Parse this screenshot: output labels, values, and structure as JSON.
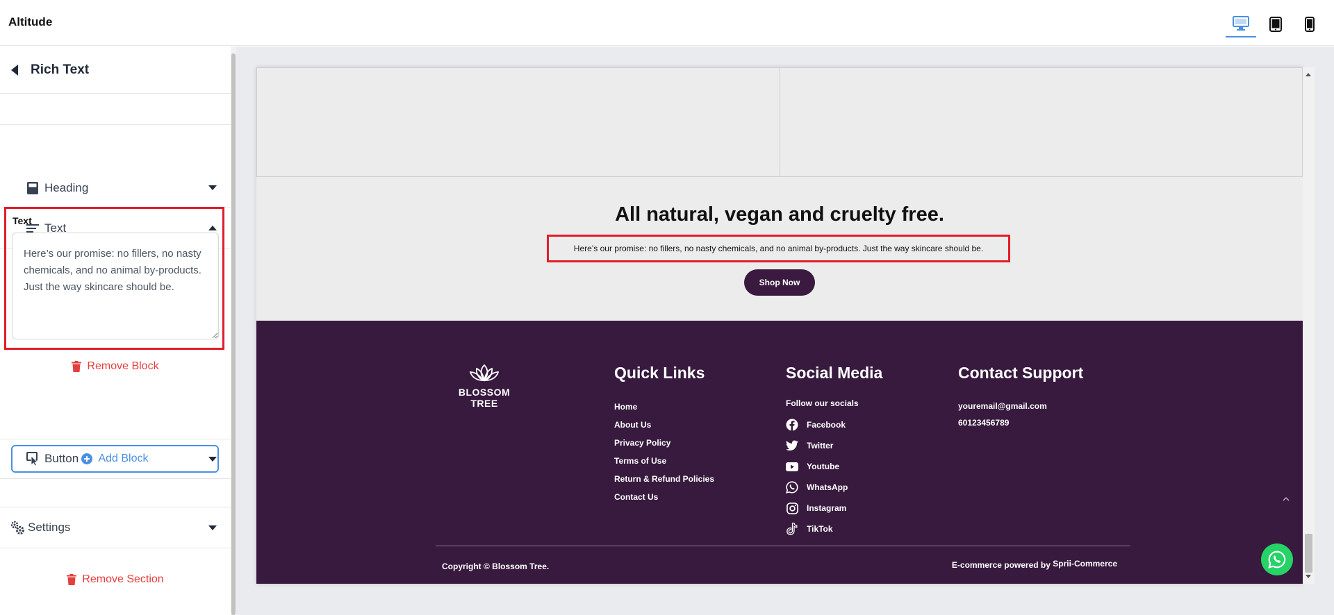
{
  "app": {
    "title": "Altitude"
  },
  "devices": [
    "desktop",
    "tablet",
    "mobile"
  ],
  "panel": {
    "title": "Rich Text",
    "blocks": [
      {
        "label": "Heading",
        "icon": "heading-block-icon",
        "state": "collapsed"
      },
      {
        "label": "Text",
        "icon": "text-lines-icon",
        "state": "expanded"
      },
      {
        "label": "Button",
        "icon": "cursor-click-icon",
        "state": "collapsed"
      }
    ],
    "text_field": {
      "label": "Text",
      "value": "Here’s our promise: no fillers, no nasty chemicals, and no animal by-products. Just the way skincare should be."
    },
    "remove_block": "Remove Block",
    "add_block": "Add Block",
    "settings": "Settings",
    "remove_section": "Remove Section"
  },
  "preview": {
    "hero": {
      "title": "All natural, vegan and cruelty free.",
      "text": "Here’s our promise: no fillers, no nasty chemicals, and no animal by-products. Just the way skincare should be.",
      "button": "Shop Now"
    },
    "footer": {
      "brand": "BLOSSOM TREE",
      "quick_links": {
        "heading": "Quick Links",
        "items": [
          "Home",
          "About Us",
          "Privacy Policy",
          "Terms of Use",
          "Return & Refund Policies",
          "Contact Us"
        ]
      },
      "social": {
        "heading": "Social Media",
        "intro": "Follow our socials",
        "items": [
          {
            "label": "Facebook",
            "icon": "facebook-icon"
          },
          {
            "label": "Twitter",
            "icon": "twitter-icon"
          },
          {
            "label": "Youtube",
            "icon": "youtube-icon"
          },
          {
            "label": "WhatsApp",
            "icon": "whatsapp-icon"
          },
          {
            "label": "Instagram",
            "icon": "instagram-icon"
          },
          {
            "label": "TikTok",
            "icon": "tiktok-icon"
          }
        ]
      },
      "contact": {
        "heading": "Contact Support",
        "email": "youremail@gmail.com",
        "phone": "60123456789"
      },
      "copyright": "Copyright © Blossom Tree.",
      "powered_prefix": "E-commerce powered by",
      "powered_brand": "Sprii-Commerce"
    }
  },
  "colors": {
    "accent": "#4a90e2",
    "danger": "#e53e3e",
    "highlight": "#e11d2a",
    "footer_bg": "#371a3e",
    "shop_button": "#3a1a3f",
    "whatsapp": "#25d366"
  }
}
